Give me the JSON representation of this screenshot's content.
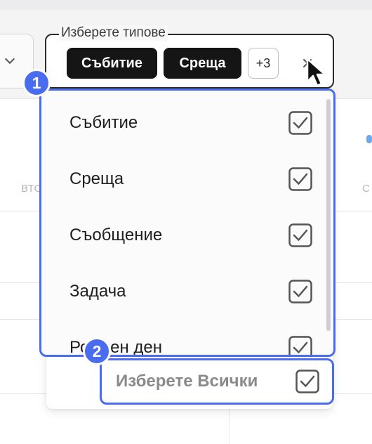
{
  "background": {
    "day_left": "ВТО",
    "day_right": "С"
  },
  "select": {
    "legend": "Изберете типове",
    "chips": [
      "Събитие",
      "Среща"
    ],
    "more_count": "+3"
  },
  "options": [
    {
      "label": "Събитие",
      "checked": true
    },
    {
      "label": "Среща",
      "checked": true
    },
    {
      "label": "Съобщение",
      "checked": true
    },
    {
      "label": "Задача",
      "checked": true
    },
    {
      "label": "Рожден ден",
      "checked": true
    }
  ],
  "select_all": {
    "label": "Изберете Всички",
    "checked": true
  },
  "annotations": {
    "badge_1": "1",
    "badge_2": "2"
  },
  "colors": {
    "accent": "#4a6df0",
    "chip": "#151515",
    "check": "#555555"
  },
  "icons": [
    "chevron-down-icon",
    "clear-icon",
    "checkbox-checked-icon",
    "mouse-pointer-icon"
  ]
}
